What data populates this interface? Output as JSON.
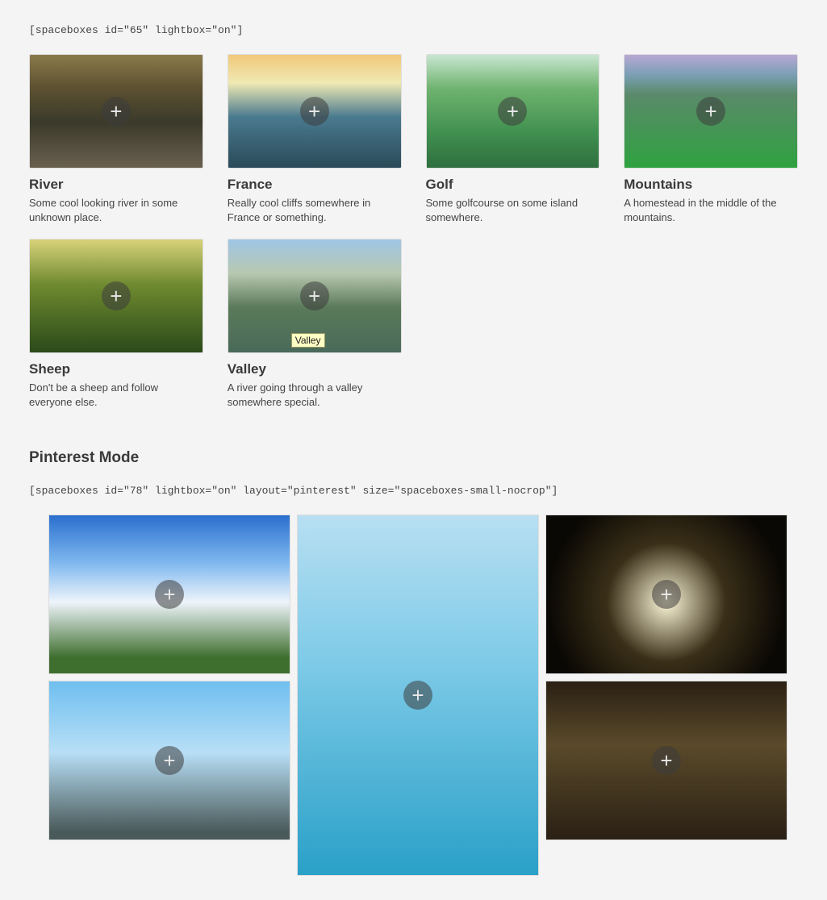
{
  "shortcode1": "[spaceboxes id=\"65\" lightbox=\"on\"]",
  "cards": [
    {
      "title": "River",
      "desc": "Some cool looking river in some unknown place."
    },
    {
      "title": "France",
      "desc": "Really cool cliffs somewhere in France or something."
    },
    {
      "title": "Golf",
      "desc": "Some golfcourse on some island somewhere."
    },
    {
      "title": "Mountains",
      "desc": "A homestead in the middle of the mountains."
    },
    {
      "title": "Sheep",
      "desc": "Don't be a sheep and follow everyone else."
    },
    {
      "title": "Valley",
      "desc": "A river going through a valley somewhere special."
    }
  ],
  "tooltip": "Valley",
  "section2_title": "Pinterest Mode",
  "shortcode2": "[spaceboxes id=\"78\" lightbox=\"on\" layout=\"pinterest\" size=\"spaceboxes-small-nocrop\"]"
}
